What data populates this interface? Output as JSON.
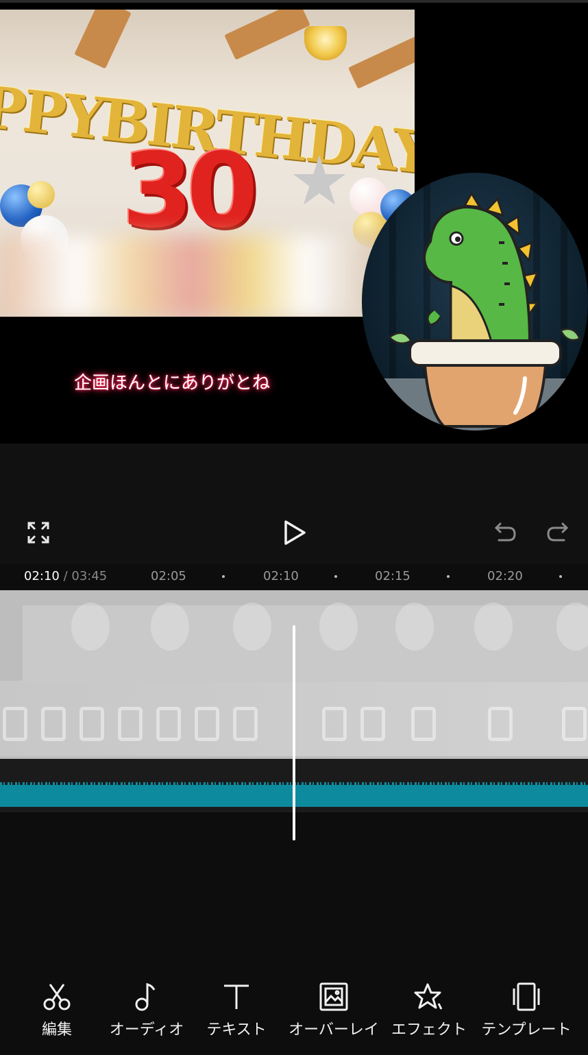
{
  "preview": {
    "banner_text": "PPYBIRTHDAY",
    "number_balloon": "30",
    "subtitle": "企画ほんとにありがとね"
  },
  "controls": {
    "fullscreen_icon": "fullscreen-expand-icon",
    "play_icon": "play-icon",
    "undo_icon": "undo-icon",
    "redo_icon": "redo-icon"
  },
  "timeline": {
    "current_time": "02:10",
    "separator": " / ",
    "total_time": "03:45",
    "ticks": [
      "02:05",
      "02:10",
      "02:15",
      "02:20"
    ]
  },
  "tracks": {
    "audio_color": "#0e8a9e"
  },
  "toolbar": {
    "items": [
      {
        "label": "編集",
        "icon": "scissors-icon"
      },
      {
        "label": "オーディオ",
        "icon": "music-note-icon"
      },
      {
        "label": "テキスト",
        "icon": "text-icon"
      },
      {
        "label": "オーバーレイ",
        "icon": "overlay-image-icon"
      },
      {
        "label": "エフェクト",
        "icon": "effect-star-icon"
      },
      {
        "label": "テンプレート",
        "icon": "template-icon"
      }
    ]
  }
}
